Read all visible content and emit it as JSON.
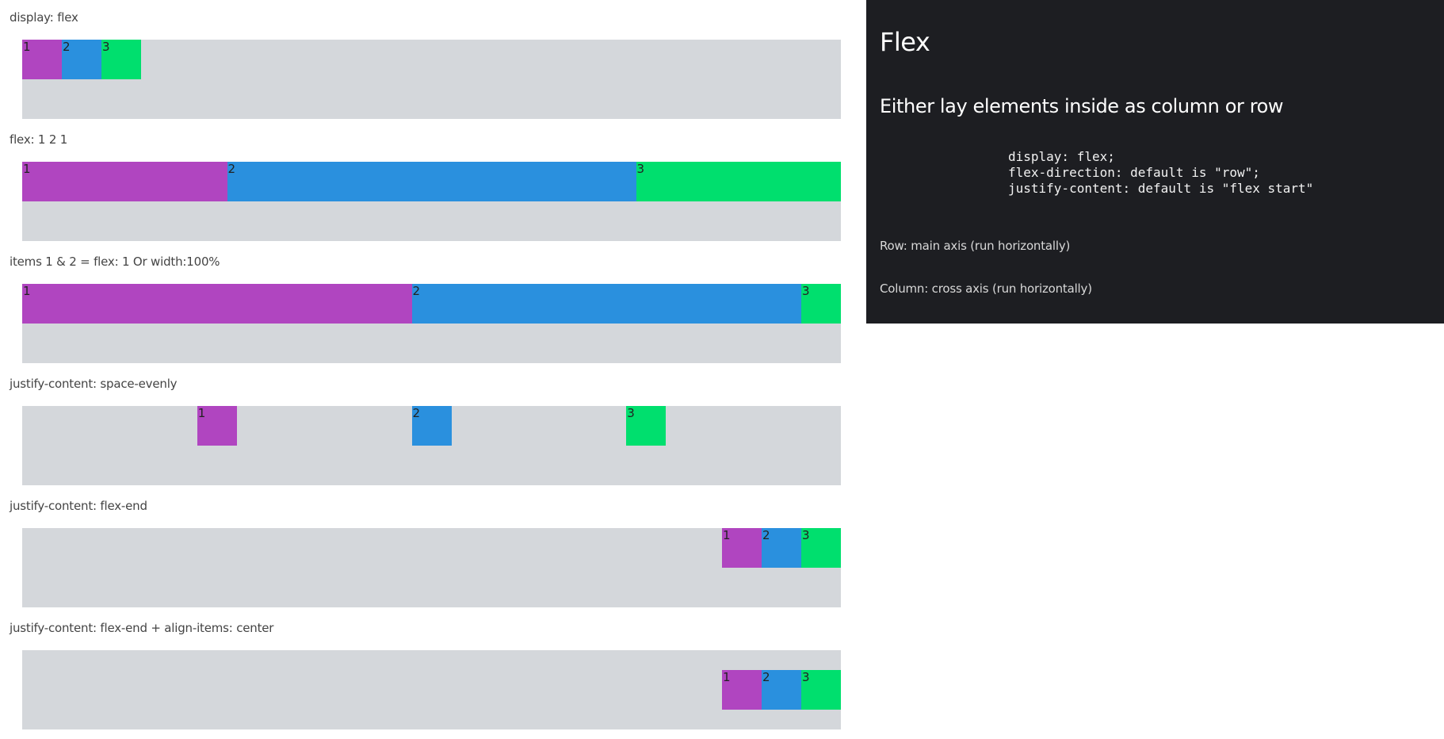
{
  "demos": [
    {
      "label": "display: flex",
      "items": [
        "1",
        "2",
        "3"
      ]
    },
    {
      "label": "flex: 1 2 1",
      "items": [
        "1",
        "2",
        "3"
      ]
    },
    {
      "label": "items 1 & 2 = flex: 1 Or width:100%",
      "items": [
        "1",
        "2",
        "3"
      ]
    },
    {
      "label": "justify-content: space-evenly",
      "items": [
        "1",
        "2",
        "3"
      ]
    },
    {
      "label": "justify-content: flex-end",
      "items": [
        "1",
        "2",
        "3"
      ]
    },
    {
      "label": "justify-content: flex-end + align-items: center",
      "items": [
        "1",
        "2",
        "3"
      ]
    }
  ],
  "colors": {
    "item1": "#b045c0",
    "item2": "#2a90de",
    "item3": "#00df6e",
    "container": "#d4d7db",
    "panel": "#1d1e22"
  },
  "panel": {
    "title": "Flex",
    "subtitle": "Either lay elements inside as column or row",
    "code_lines": [
      "display: flex;",
      "flex-direction: default is \"row\";",
      "justify-content: default is \"flex start\""
    ],
    "note_row": "Row: main axis (run horizontally)",
    "note_column": "Column: cross axis (run horizontally)"
  }
}
